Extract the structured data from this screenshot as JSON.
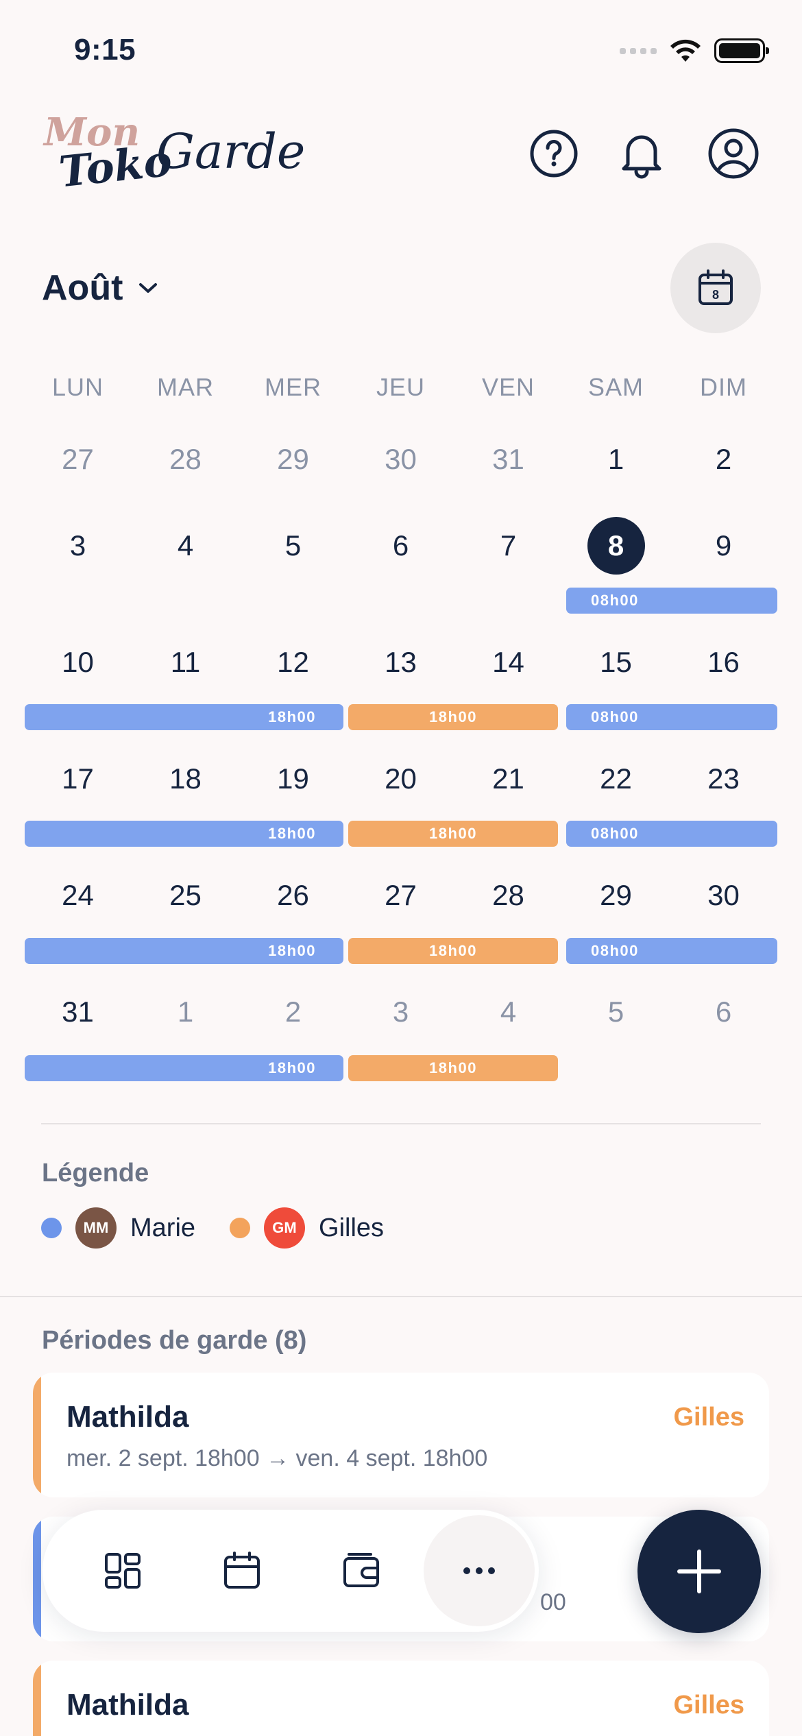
{
  "status_bar": {
    "time": "9:15"
  },
  "header": {
    "logo": {
      "line1": "Mon",
      "line2": "Toko",
      "line3": "Garde"
    },
    "icons": [
      "help-icon",
      "bell-icon",
      "profile-icon"
    ]
  },
  "calendar": {
    "month_label": "Août",
    "today_icon_day": "8",
    "weekdays": [
      "LUN",
      "MAR",
      "MER",
      "JEU",
      "VEN",
      "SAM",
      "DIM"
    ],
    "weeks": [
      [
        "27",
        "28",
        "29",
        "30",
        "31",
        "1",
        "2"
      ],
      [
        "3",
        "4",
        "5",
        "6",
        "7",
        "8",
        "9"
      ],
      [
        "10",
        "11",
        "12",
        "13",
        "14",
        "15",
        "16"
      ],
      [
        "17",
        "18",
        "19",
        "20",
        "21",
        "22",
        "23"
      ],
      [
        "24",
        "25",
        "26",
        "27",
        "28",
        "29",
        "30"
      ],
      [
        "31",
        "1",
        "2",
        "3",
        "4",
        "5",
        "6"
      ]
    ],
    "bar_labels": {
      "w1_sat": "08h00",
      "w2_a": "18h00",
      "w2_b": "18h00",
      "w2_c": "08h00",
      "w3_a": "18h00",
      "w3_b": "18h00",
      "w3_c": "08h00",
      "w4_a": "18h00",
      "w4_b": "18h00",
      "w4_c": "08h00",
      "w5_a": "18h00",
      "w5_b": "18h00"
    },
    "colors": {
      "marie": "#7fa3ee",
      "gilles": "#f3aa68",
      "today": "#16243f"
    }
  },
  "legend": {
    "title": "Légende",
    "items": [
      {
        "initials": "MM",
        "name": "Marie",
        "dot_color": "#6d95ea",
        "avatar_color": "#7a5545"
      },
      {
        "initials": "GM",
        "name": "Gilles",
        "dot_color": "#f3a35c",
        "avatar_color": "#ef4b3a"
      }
    ]
  },
  "periods": {
    "title": "Périodes de garde (8)",
    "cards": [
      {
        "child": "Mathilda",
        "owner": "Gilles",
        "range": "mer. 2 sept. 18h00 → ven. 4 sept. 18h00",
        "color": "#f3aa68",
        "owner_color": "#f0994a"
      },
      {
        "child": "",
        "owner": "",
        "range": "00",
        "color": "#6d95ea",
        "owner_color": "#6d95ea"
      },
      {
        "child": "Mathilda",
        "owner": "Gilles",
        "range": "",
        "color": "#f3aa68",
        "owner_color": "#f0994a"
      }
    ]
  },
  "bottom_nav": {
    "items": [
      "dashboard-icon",
      "calendar-icon",
      "wallet-icon",
      "more-icon"
    ],
    "more_label": "•••",
    "fab_label": "+"
  }
}
